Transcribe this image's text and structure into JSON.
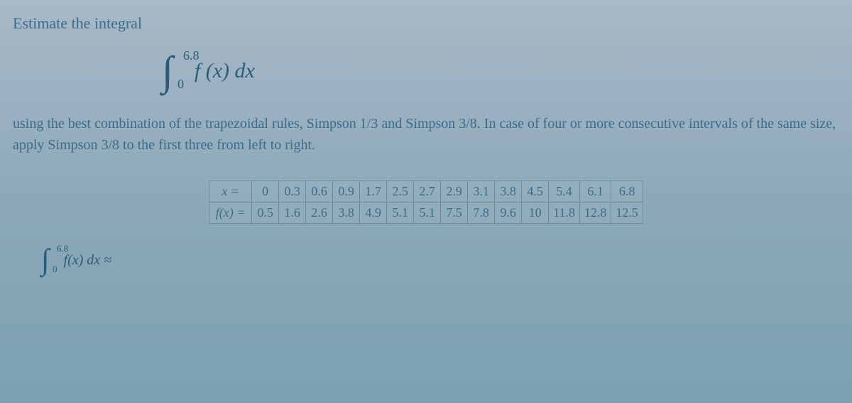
{
  "prompt": "Estimate the integral",
  "integral": {
    "upper": "6.8",
    "lower": "0",
    "integrand": "f (x) dx"
  },
  "instruction": "using the best combination of the trapezoidal rules, Simpson 1/3 and Simpson 3/8. In case of four or more consecutive intervals of the same size, apply Simpson 3/8 to the first three from left to right.",
  "table": {
    "row_headers": [
      "x =",
      "f(x) ="
    ],
    "x": [
      "0",
      "0.3",
      "0.6",
      "0.9",
      "1.7",
      "2.5",
      "2.7",
      "2.9",
      "3.1",
      "3.8",
      "4.5",
      "5.4",
      "6.1",
      "6.8"
    ],
    "fx": [
      "0.5",
      "1.6",
      "2.6",
      "3.8",
      "4.9",
      "5.1",
      "5.1",
      "7.5",
      "7.8",
      "9.6",
      "10",
      "11.8",
      "12.8",
      "12.5"
    ]
  },
  "answer": {
    "upper": "6.8",
    "lower": "0",
    "integrand": "f(x) dx ≈"
  }
}
